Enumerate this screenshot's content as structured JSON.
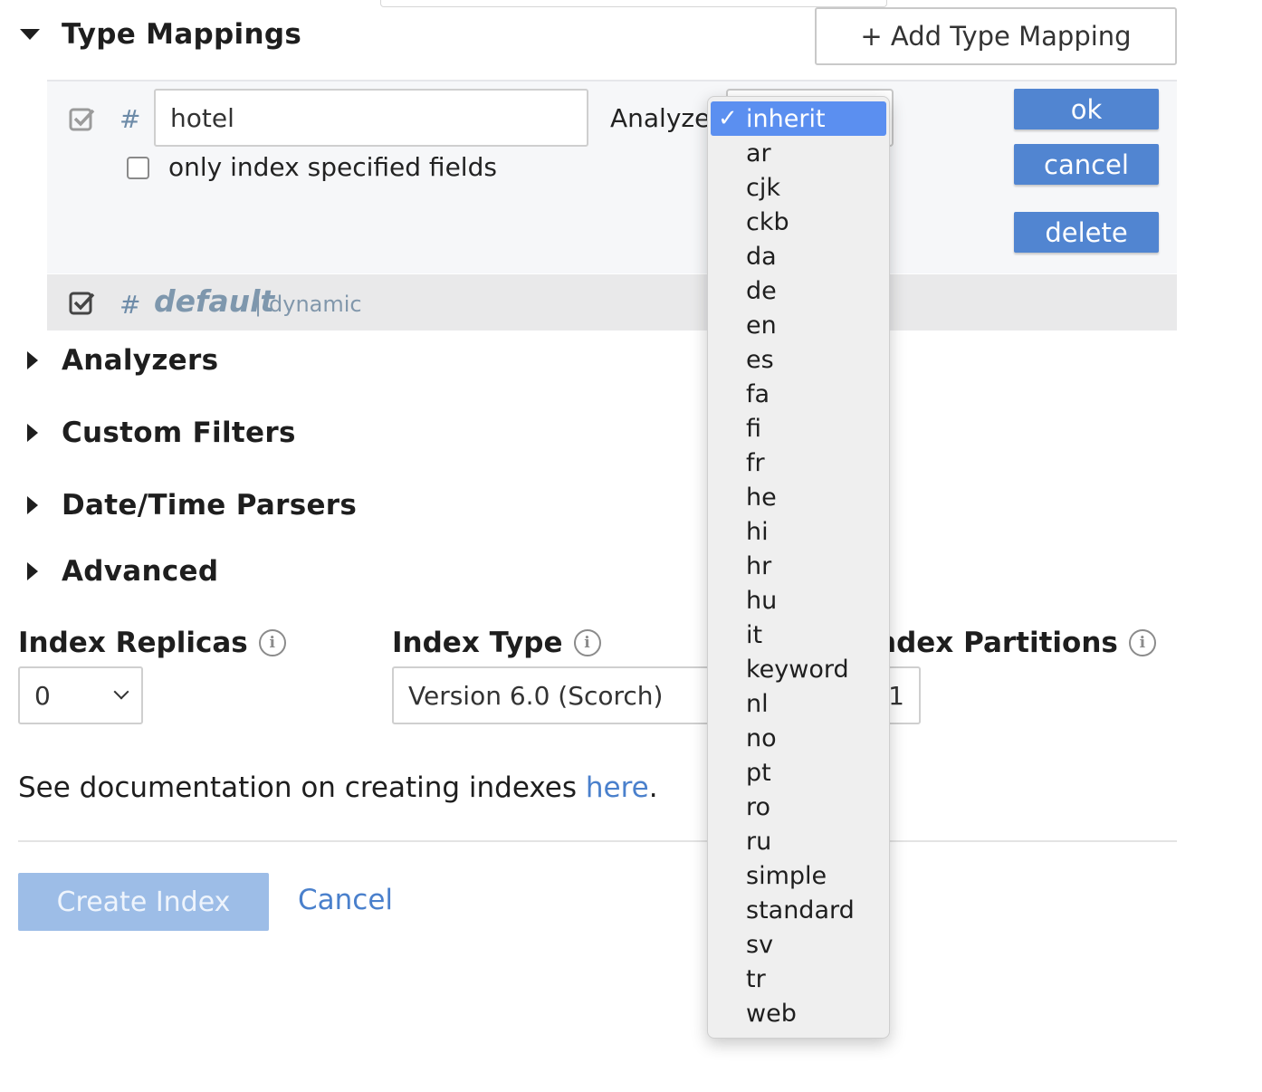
{
  "type_mappings": {
    "title": "Type Mappings",
    "add_button": "+ Add Type Mapping",
    "editing": {
      "hash": "#",
      "type_name": "hotel",
      "only_index_label": "only index specified fields",
      "only_index_checked": false,
      "enabled_checked": true,
      "analyzer_label": "Analyzer",
      "ok": "ok",
      "cancel": "cancel",
      "delete": "delete"
    },
    "default_row": {
      "hash": "#",
      "name": "default",
      "separator": "|",
      "mode": "dynamic",
      "checked": true
    }
  },
  "sections": [
    {
      "label": "Analyzers"
    },
    {
      "label": "Custom Filters"
    },
    {
      "label": "Date/Time Parsers"
    },
    {
      "label": "Advanced"
    }
  ],
  "settings": {
    "replicas_label": "Index Replicas",
    "replicas_value": "0",
    "type_label": "Index Type",
    "type_value": "Version 6.0 (Scorch)",
    "partitions_label": "Index Partitions",
    "partitions_label_visible": "ndex Partitions",
    "partitions_value": "1",
    "info_glyph": "i"
  },
  "documentation": {
    "text": "See documentation on creating indexes ",
    "link": "here",
    "suffix": "."
  },
  "footer": {
    "create": "Create Index",
    "cancel": "Cancel"
  },
  "analyzer_dropdown": {
    "selected": "inherit",
    "check": "✓",
    "options": [
      "inherit",
      "ar",
      "cjk",
      "ckb",
      "da",
      "de",
      "en",
      "es",
      "fa",
      "fi",
      "fr",
      "he",
      "hi",
      "hr",
      "hu",
      "it",
      "keyword",
      "nl",
      "no",
      "pt",
      "ro",
      "ru",
      "simple",
      "standard",
      "sv",
      "tr",
      "web"
    ]
  }
}
